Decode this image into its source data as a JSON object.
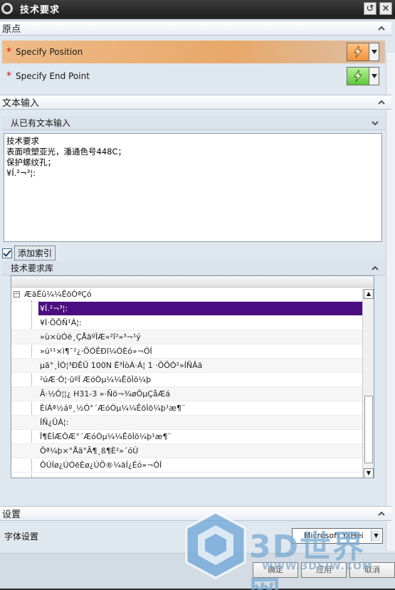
{
  "window": {
    "title": "技术要求",
    "buttons": [
      "↺",
      "✕"
    ]
  },
  "sections": {
    "origin": {
      "label": "原点",
      "rows": [
        {
          "label": "Specify Position",
          "state": "active"
        },
        {
          "label": "Specify End Point",
          "state": "normal"
        }
      ]
    },
    "text_input": {
      "label": "文本输入",
      "sub_label": "从已有文本输入",
      "text": "技术要求\n表面喷塑亚光，潘通色号448C；\n保护螺纹孔；\n¥Í.²¬³¦:",
      "checkbox_label": "添加索引",
      "checkbox_checked": true
    },
    "library": {
      "label": "技术要求库",
      "root": "ÆäËû¼¼ÊõÒªÇó",
      "items": [
        "¥Í.²¬³¦:",
        "¥Í·ÖÕÑ¹Á¦:",
        "»ù×ùÓë¸ÇÅäºÏÆ«²î²»³¬¹ý",
        "»ú¹¹×ì¶¯²¿·ÖÓÊÐî¼ÓÈó»¬ÓÍ",
        "µã°¸ÌÓ¦³ÐÊÜ 100N Ë³ÌòÀ·Á¦ 1 ·ÖÖÓ²»ÍÑÂä",
        "²úÆ·Ó¦·ûºÏ        ÆóÒµ¼¼ÊõÌõ¼þ",
        "Ã·½Ó¦¦¿ H31-3 »·Ñõ¬¾øÔµÇåÆá",
        "ÈíÁª½áº¸½Ó°´ÆóÒµ¼¼ÊõÌõ¼þ¹æ¶¨",
        "ÍÑ¿ÛÁ¦:",
        "Ï¶ÈÌÆÔÆ°´ÆóÒµ¼¼ÊõÌõ¼þ¹æ¶¨",
        "Ôª¼þ×°Åä°Ã¶¸ß¶È²»´óÚ",
        "ÔÚÍø¿ÚÓëÈø¿ÚÖ®¼äÍ¿Éó»¬ÓÍ"
      ]
    },
    "settings": {
      "label": "设置",
      "font_label": "字体设置",
      "font_value": "Microsoft YaHei"
    }
  },
  "footer": {
    "buttons": [
      "确定",
      "应用",
      "取消"
    ]
  },
  "watermark": {
    "text": "3D世界网",
    "url": "WWW.3DSJW.COM"
  },
  "icons": {
    "section_expanded": "chevron-up-icon",
    "subsection_collapsed": "chevron-down-icon",
    "point_picker": "lightning-icon"
  },
  "colors": {
    "active_row": "#e8a86a",
    "selected_tree_row": "#4b0e82",
    "required_star": "#d01010"
  }
}
